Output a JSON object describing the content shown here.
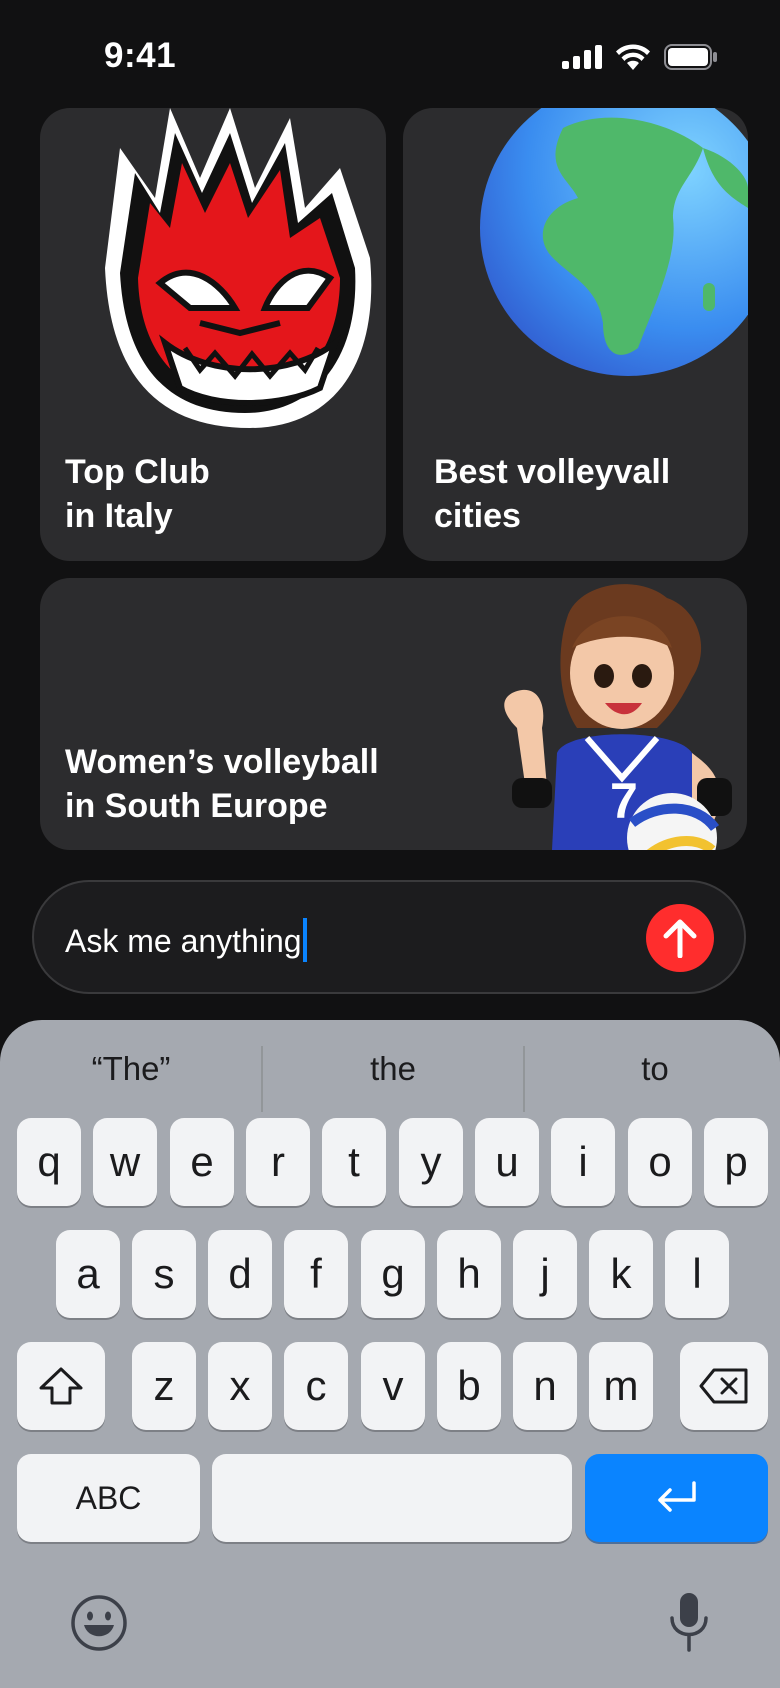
{
  "status": {
    "time": "9:41"
  },
  "cards": [
    {
      "line1": "Top Club",
      "line2": "in Italy",
      "image": "red-dragon-mascot"
    },
    {
      "line1": "Best volleyvall",
      "line2": "cities",
      "image": "globe-emoji"
    },
    {
      "line1": "Women’s volleyball",
      "line2": "in South Europe",
      "image": "volleyball-player-girl"
    }
  ],
  "input": {
    "placeholder": "Ask me anything"
  },
  "keyboard": {
    "suggestions": [
      "“The”",
      "the",
      "to"
    ],
    "row1": [
      "q",
      "w",
      "e",
      "r",
      "t",
      "y",
      "u",
      "i",
      "o",
      "p"
    ],
    "row2": [
      "a",
      "s",
      "d",
      "f",
      "g",
      "h",
      "j",
      "k",
      "l"
    ],
    "row3": [
      "z",
      "x",
      "c",
      "v",
      "b",
      "n",
      "m"
    ],
    "abc_label": "ABC"
  },
  "colors": {
    "send": "#ff2d2d",
    "return": "#0a84ff",
    "card": "#2c2c2e"
  },
  "icons": [
    "signal-icon",
    "wifi-icon",
    "battery-icon",
    "arrow-up-icon",
    "shift-icon",
    "backspace-icon",
    "return-icon",
    "emoji-icon",
    "microphone-icon"
  ]
}
